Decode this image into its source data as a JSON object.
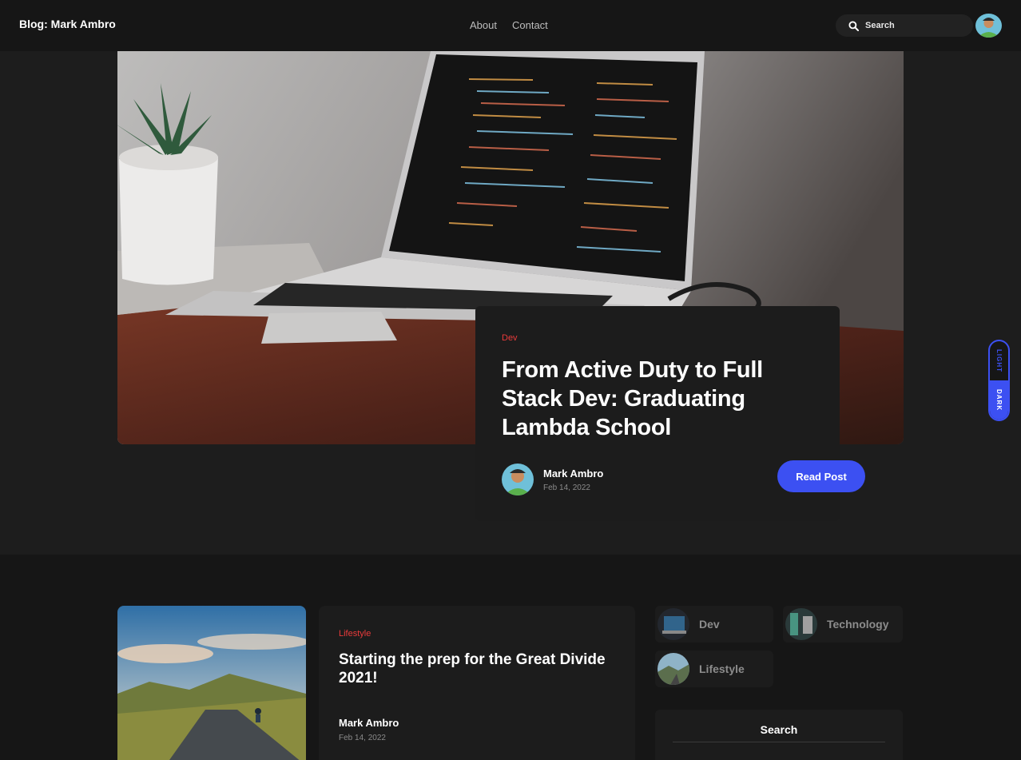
{
  "header": {
    "brand": "Blog: Mark Ambro",
    "nav": [
      "About",
      "Contact"
    ],
    "search_placeholder": "Search"
  },
  "featured": {
    "category": "Dev",
    "title": "From Active Duty to Full Stack Dev: Graduating Lambda School",
    "author": "Mark Ambro",
    "date": "Feb 14, 2022",
    "read_label": "Read Post"
  },
  "theme_toggle": {
    "light": "LIGHT",
    "dark": "DARK",
    "active": "dark"
  },
  "post": {
    "category": "Lifestyle",
    "title": "Starting the prep for the Great Divide 2021!",
    "author": "Mark Ambro",
    "date": "Feb 14, 2022"
  },
  "sidebar": {
    "categories": [
      "Dev",
      "Technology",
      "Lifestyle"
    ],
    "search_title": "Search"
  },
  "colors": {
    "accent": "#3c50f2",
    "category": "#ea3b3b",
    "background": "#1d1d1d"
  }
}
